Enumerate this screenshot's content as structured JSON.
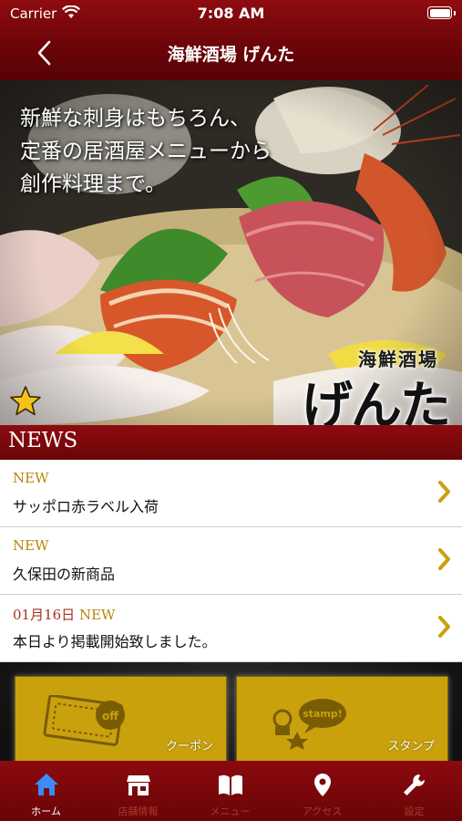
{
  "status_bar": {
    "carrier": "Carrier",
    "time": "7:08 AM"
  },
  "nav": {
    "title": "海鮮酒場 げんた",
    "back_icon": "chevron-left-icon"
  },
  "hero": {
    "tagline": [
      "新鮮な刺身はもちろん、",
      "定番の居酒屋メニューから",
      "創作料理まで。"
    ],
    "brand_sub": "海鮮酒場",
    "brand_main": "げんた",
    "favorite_icon": "star-icon"
  },
  "news": {
    "heading": "NEWS",
    "items": [
      {
        "date": "",
        "tag": "NEW",
        "text": "サッポロ赤ラベル入荷"
      },
      {
        "date": "",
        "tag": "NEW",
        "text": "久保田の新商品"
      },
      {
        "date": "01月16日",
        "tag": "NEW",
        "text": "本日より掲載開始致しました。"
      }
    ]
  },
  "tiles": [
    {
      "label": "クーポン",
      "icon": "coupon-icon"
    },
    {
      "label": "スタンプ",
      "icon": "stamp-icon"
    }
  ],
  "tabbar": [
    {
      "label": "ホーム",
      "icon": "home-icon",
      "active": true
    },
    {
      "label": "店舗情報",
      "icon": "store-icon",
      "active": false
    },
    {
      "label": "メニュー",
      "icon": "book-icon",
      "active": false
    },
    {
      "label": "アクセス",
      "icon": "location-pin-icon",
      "active": false
    },
    {
      "label": "設定",
      "icon": "wrench-icon",
      "active": false
    }
  ],
  "colors": {
    "brand_red": "#7a0609",
    "accent_gold": "#c9a10d",
    "new_tag": "#b8860b",
    "date_text": "#a8321e",
    "tab_active": "#ffffff",
    "tab_inactive": "#a93a2a"
  }
}
